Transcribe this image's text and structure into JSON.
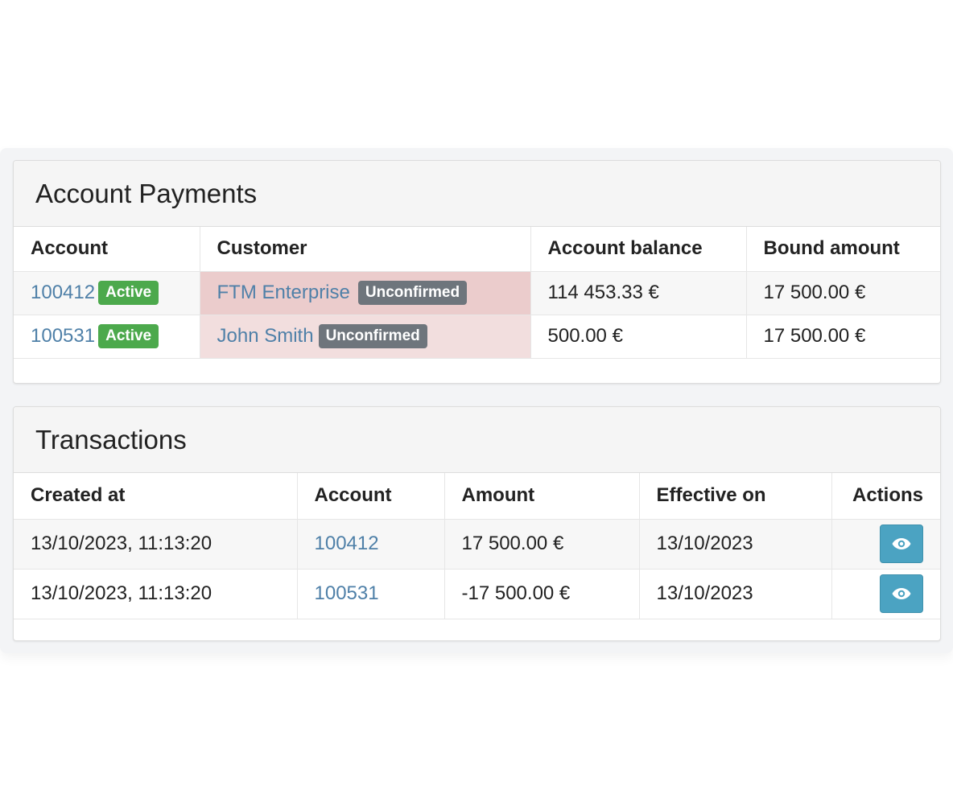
{
  "account_payments": {
    "title": "Account Payments",
    "columns": [
      "Account",
      "Customer",
      "Account balance",
      "Bound amount"
    ],
    "rows": [
      {
        "account": "100412",
        "account_status": "Active",
        "customer": "FTM Enterprise",
        "customer_status": "Unconfirmed",
        "balance": "114 453.33 €",
        "bound": "17 500.00 €"
      },
      {
        "account": "100531",
        "account_status": "Active",
        "customer": "John Smith",
        "customer_status": "Unconfirmed",
        "balance": "500.00 €",
        "bound": "17 500.00 €"
      }
    ]
  },
  "transactions": {
    "title": "Transactions",
    "columns": [
      "Created at",
      "Account",
      "Amount",
      "Effective on",
      "Actions"
    ],
    "rows": [
      {
        "created_at": "13/10/2023, 11:13:20",
        "account": "100412",
        "amount": "17 500.00 €",
        "effective_on": "13/10/2023",
        "action_icon": "eye-icon"
      },
      {
        "created_at": "13/10/2023, 11:13:20",
        "account": "100531",
        "amount": "-17 500.00 €",
        "effective_on": "13/10/2023",
        "action_icon": "eye-icon"
      }
    ]
  },
  "colors": {
    "link": "#4f80a8",
    "success_badge": "#4ca94c",
    "muted_badge": "#6e757c",
    "danger_cell": "#f2dede",
    "info_button": "#4ba3c2"
  }
}
